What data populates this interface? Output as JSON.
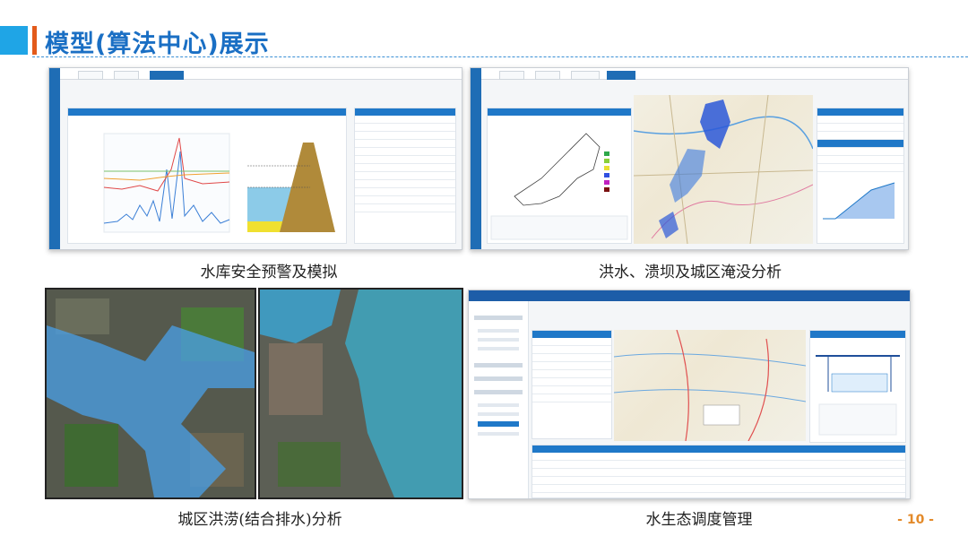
{
  "slide": {
    "title": "模型(算法中心)展示",
    "page_number": "- 10 -",
    "accent_color": "#1fa5e6",
    "bar_color": "#e35a1a",
    "title_color": "#1a6fc4"
  },
  "panels": [
    {
      "caption": "水库安全预警及模拟"
    },
    {
      "caption": "洪水、溃坝及城区淹没分析"
    },
    {
      "caption": "城区洪涝(结合排水)分析"
    },
    {
      "caption": "水生态调度管理"
    }
  ]
}
